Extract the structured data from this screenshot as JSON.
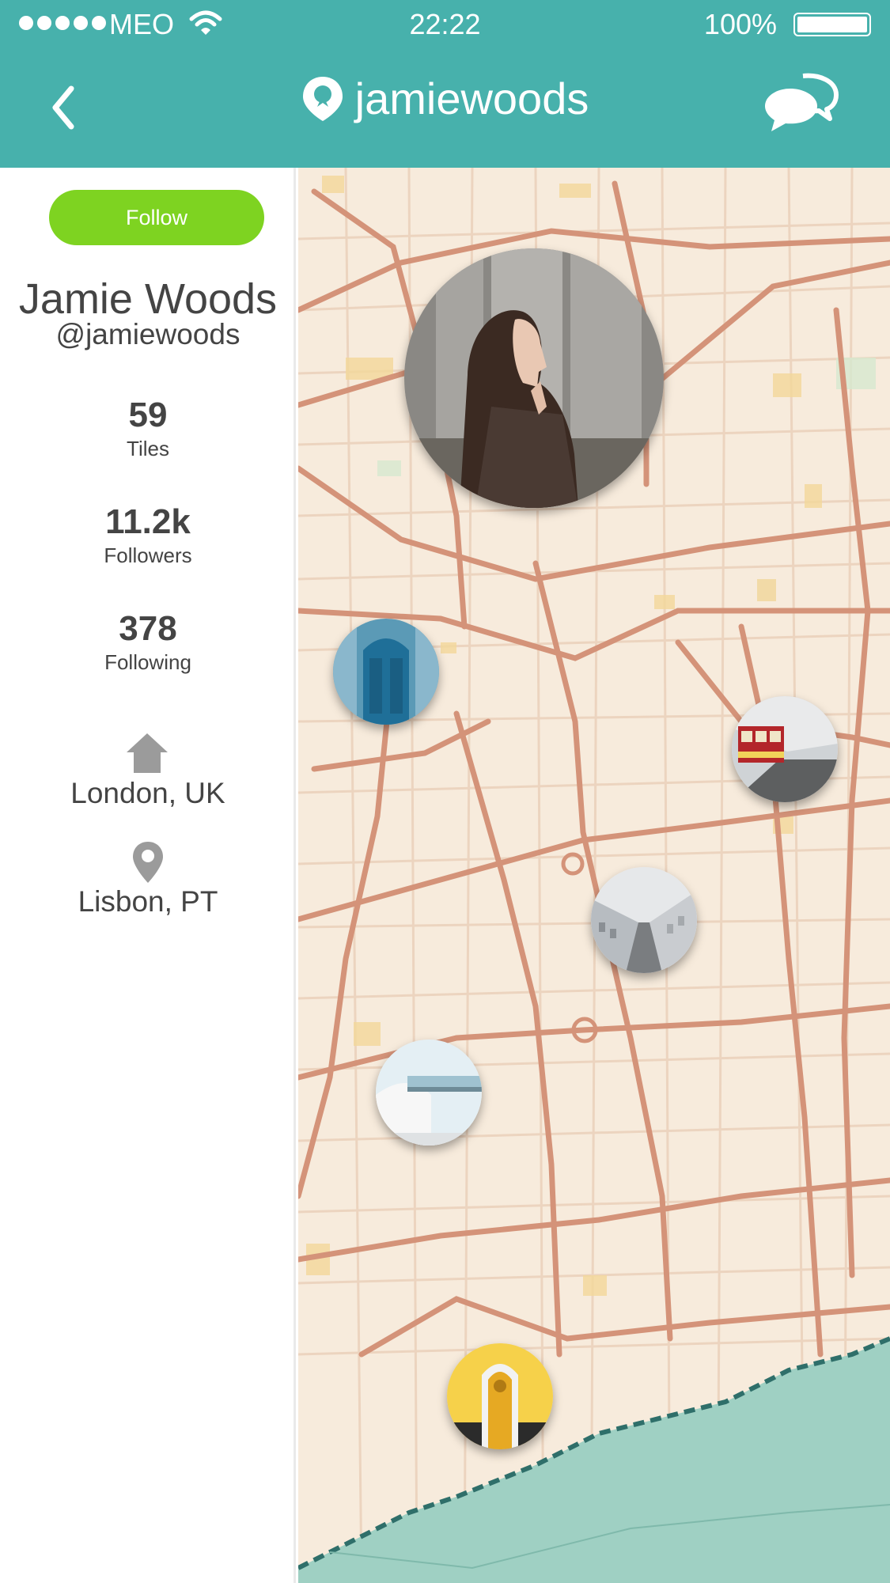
{
  "status_bar": {
    "carrier": "MEO",
    "time": "22:22",
    "battery_percent": "100%"
  },
  "nav": {
    "title": "jamiewoods"
  },
  "profile": {
    "follow_label": "Follow",
    "name": "Jamie Woods",
    "handle": "@jamiewoods",
    "stats": [
      {
        "value": "59",
        "label": "Tiles"
      },
      {
        "value": "11.2k",
        "label": "Followers"
      },
      {
        "value": "378",
        "label": "Following"
      }
    ],
    "home_location": "London, UK",
    "current_location": "Lisbon, PT"
  },
  "colors": {
    "accent": "#47b1ac",
    "follow": "#7ed321",
    "text": "#444444",
    "map_land": "#f7ebdc",
    "map_road": "#d49379",
    "map_water": "#9fd0c3"
  }
}
